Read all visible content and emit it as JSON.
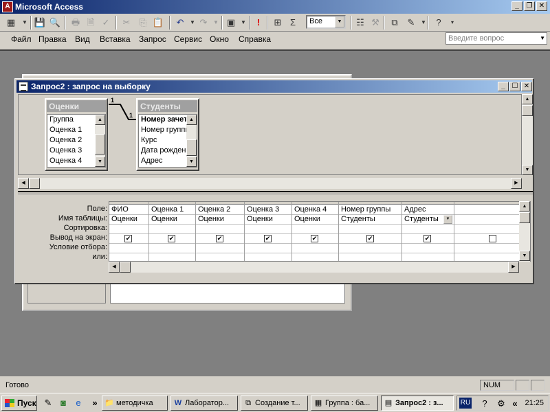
{
  "app": {
    "title": "Microsoft Access",
    "icon_letter": "A"
  },
  "toolbar": {
    "combo_value": "Все"
  },
  "menu": [
    "Файл",
    "Правка",
    "Вид",
    "Вставка",
    "Запрос",
    "Сервис",
    "Окно",
    "Справка"
  ],
  "help_search": {
    "placeholder": "Введите вопрос"
  },
  "query_window": {
    "title": "Запрос2 : запрос на выборку",
    "tables": [
      {
        "name": "Оценки",
        "fields": [
          "Группа",
          "Оценка 1",
          "Оценка 2",
          "Оценка 3",
          "Оценка 4"
        ]
      },
      {
        "name": "Студенты",
        "fields": [
          "Номер зачетн",
          "Номер группы",
          "Курс",
          "Дата рожден",
          "Адрес"
        ]
      }
    ],
    "relation": {
      "left_label": "1",
      "right_label": "1"
    },
    "grid": {
      "row_labels": [
        "Поле:",
        "Имя таблицы:",
        "Сортировка:",
        "Вывод на экран:",
        "Условие отбора:",
        "или:"
      ],
      "columns": [
        {
          "field": "ФИО",
          "table": "Оценки",
          "show": true
        },
        {
          "field": "Оценка 1",
          "table": "Оценки",
          "show": true
        },
        {
          "field": "Оценка 2",
          "table": "Оценки",
          "show": true
        },
        {
          "field": "Оценка 3",
          "table": "Оценки",
          "show": true
        },
        {
          "field": "Оценка 4",
          "table": "Оценки",
          "show": true
        },
        {
          "field": "Номер группы",
          "table": "Студенты",
          "show": true
        },
        {
          "field": "Адрес",
          "table": "Студенты",
          "show": true
        },
        {
          "field": "",
          "table": "",
          "show": false
        }
      ]
    }
  },
  "status": {
    "text": "Готово",
    "num": "NUM"
  },
  "taskbar": {
    "start": "Пуск",
    "tasks": [
      "методичка",
      "Лаборатор...",
      "Создание т...",
      "Группа : ба...",
      "Запрос2 : з..."
    ],
    "lang": "RU",
    "clock": "21:25"
  }
}
